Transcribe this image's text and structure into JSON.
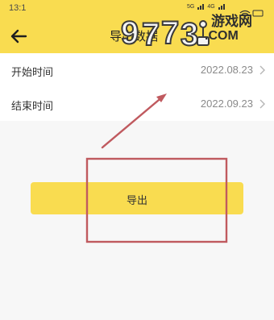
{
  "status_bar": {
    "time": "13:1",
    "signal_1": "5G",
    "signal_2": "4G"
  },
  "header": {
    "back_icon": "arrow-left-icon",
    "title": "导出数据",
    "watermark": {
      "logo_digits": "9773",
      "logo_site": "游戏网",
      "logo_domain": ".COM"
    }
  },
  "form": {
    "rows": [
      {
        "label": "开始时间",
        "value": "2022.08.23",
        "icon": "chevron-right-icon"
      },
      {
        "label": "结束时间",
        "value": "2022.09.23",
        "icon": "chevron-right-icon"
      }
    ]
  },
  "export_button": {
    "label": "导出"
  },
  "colors": {
    "accent": "#f9dc50",
    "annotation": "#c05a5f",
    "row_bg": "#ffffff",
    "page_bg": "#f7f7f7"
  }
}
